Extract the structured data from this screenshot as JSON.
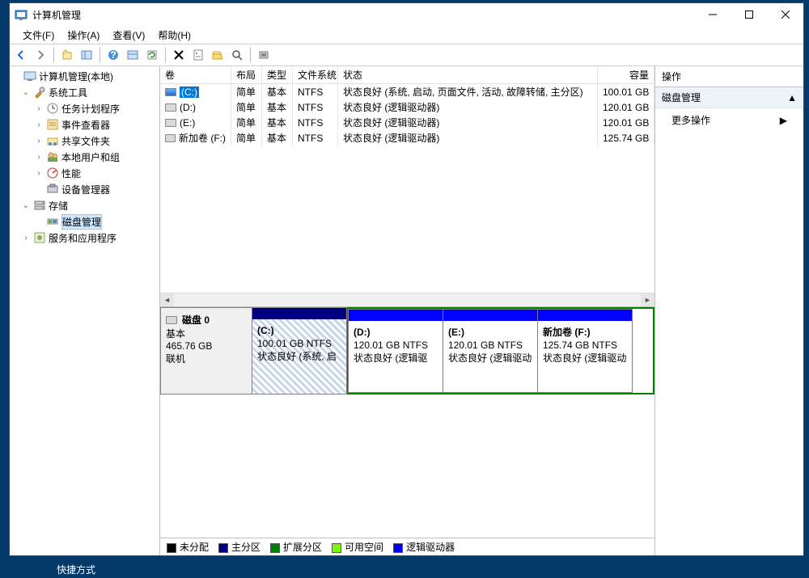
{
  "window": {
    "title": "计算机管理"
  },
  "menu": {
    "file": "文件(F)",
    "action": "操作(A)",
    "view": "查看(V)",
    "help": "帮助(H)"
  },
  "tree": {
    "root": "计算机管理(本地)",
    "system_tools": "系统工具",
    "task_scheduler": "任务计划程序",
    "event_viewer": "事件查看器",
    "shared_folders": "共享文件夹",
    "local_users": "本地用户和组",
    "performance": "性能",
    "device_manager": "设备管理器",
    "storage": "存储",
    "disk_mgmt": "磁盘管理",
    "services_apps": "服务和应用程序"
  },
  "volumes": {
    "headers": {
      "vol": "卷",
      "layout": "布局",
      "type": "类型",
      "fs": "文件系统",
      "status": "状态",
      "capacity": "容量"
    },
    "rows": [
      {
        "name": "(C:)",
        "layout": "简单",
        "type": "基本",
        "fs": "NTFS",
        "status": "状态良好 (系统, 启动, 页面文件, 活动, 故障转储, 主分区)",
        "capacity": "100.01 GB",
        "selected": true
      },
      {
        "name": "(D:)",
        "layout": "简单",
        "type": "基本",
        "fs": "NTFS",
        "status": "状态良好 (逻辑驱动器)",
        "capacity": "120.01 GB",
        "selected": false
      },
      {
        "name": "(E:)",
        "layout": "简单",
        "type": "基本",
        "fs": "NTFS",
        "status": "状态良好 (逻辑驱动器)",
        "capacity": "120.01 GB",
        "selected": false
      },
      {
        "name": "新加卷 (F:)",
        "layout": "简单",
        "type": "基本",
        "fs": "NTFS",
        "status": "状态良好 (逻辑驱动器)",
        "capacity": "125.74 GB",
        "selected": false
      }
    ]
  },
  "disk": {
    "label": "磁盘 0",
    "type": "基本",
    "size": "465.76 GB",
    "state": "联机",
    "partitions": [
      {
        "title": "(C:)",
        "line2": "100.01 GB NTFS",
        "line3": "状态良好 (系统, 启",
        "bar": "darkblue",
        "hatch": true,
        "ext": false,
        "w": 118
      },
      {
        "title": "(D:)",
        "line2": "120.01 GB NTFS",
        "line3": "状态良好 (逻辑驱",
        "bar": "blue",
        "hatch": false,
        "ext": true,
        "w": 118
      },
      {
        "title": "(E:)",
        "line2": "120.01 GB NTFS",
        "line3": "状态良好 (逻辑驱动",
        "bar": "blue",
        "hatch": false,
        "ext": true,
        "w": 118
      },
      {
        "title": "新加卷  (F:)",
        "line2": "125.74 GB NTFS",
        "line3": "状态良好 (逻辑驱动",
        "bar": "blue",
        "hatch": false,
        "ext": true,
        "w": 118
      }
    ]
  },
  "legend": {
    "unallocated": "未分配",
    "primary": "主分区",
    "extended": "扩展分区",
    "free": "可用空间",
    "logical": "逻辑驱动器"
  },
  "actions": {
    "header": "操作",
    "disk_mgmt": "磁盘管理",
    "more": "更多操作"
  },
  "taskbar": "快捷方式"
}
